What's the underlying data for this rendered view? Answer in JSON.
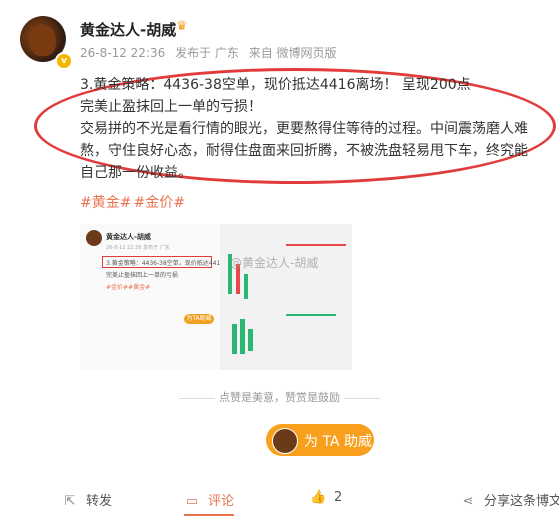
{
  "author": {
    "name": "黄金达人-胡威",
    "meta": [
      "26-8-12 22:36",
      "发布于 广东",
      "来自 微博网页版"
    ]
  },
  "post": {
    "lines": [
      "3.黄金策略：4436-38空单，现价抵达4416离场！ 呈现200点",
      "完美止盈抹回上一单的亏损！",
      "交易拼的不光是看行情的眼光，更要熬得住等待的过程。中间震荡磨人难",
      "熬，守住良好心态，耐得住盘面来回折腾，不被洗盘轻易甩下车，终究能",
      "自己那一份收益。"
    ],
    "tags": [
      "#黄金#",
      "#金价#"
    ]
  },
  "thumbnail": {
    "name": "黄金达人-胡威",
    "meta": "26-8-12 22:36 发布于 广东",
    "line1": "3.黄金策略：4436-38空单，现价抵达4416离场",
    "line2": "完美止盈抹回上一单的亏损",
    "line3": "#金价##黄金#",
    "watermark": "@黄金达人-胡威",
    "button": "为TA助威"
  },
  "encourage_text": "点赞是美意，赞赏是鼓励",
  "support_button": "为 TA 助威",
  "actions": {
    "repost": "转发",
    "comment": "评论",
    "like_count": "2",
    "share": "分享这条博文"
  }
}
